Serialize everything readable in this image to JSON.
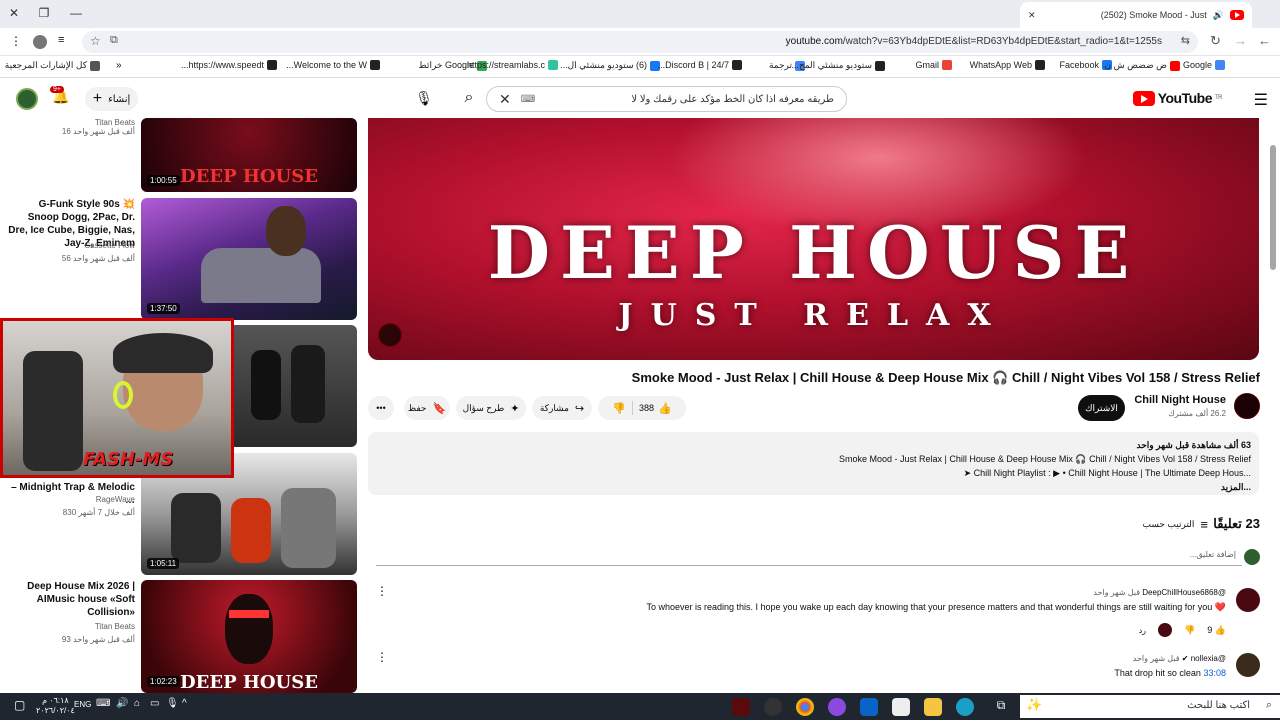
{
  "browser": {
    "tab_title": "(2502) Smoke Mood - Just",
    "url_host": "youtube.com",
    "url_rest": "/watch?v=63Yb4dpEDtE&list=RD63Yb4dpEDtE&start_radio=1&t=1255s"
  },
  "bookmarks": [
    {
      "label": "كل الإشارات المرجعية",
      "color": "#555"
    },
    {
      "label": "https://www.speedt...",
      "color": "#222"
    },
    {
      "label": "Welcome to the W...",
      "color": "#222"
    },
    {
      "label": "Google خرائط",
      "color": "#34a853"
    },
    {
      "label": "https://streamlabs.c...",
      "color": "#31c3a2"
    },
    {
      "label": "(6) ستوديو منشئي ال...",
      "color": "#1877f2"
    },
    {
      "label": "24/7 | Discord B...",
      "color": "#222"
    },
    {
      "label": "ترجمة",
      "color": "#4285f4"
    },
    {
      "label": "ستوديو منشئي المح...",
      "color": "#222"
    },
    {
      "label": "Gmail",
      "color": "#ea4335"
    },
    {
      "label": "WhatsApp Web",
      "color": "#222"
    },
    {
      "label": "Facebook",
      "color": "#1877f2"
    },
    {
      "label": "ض ضضض ش ن",
      "color": "#f00"
    },
    {
      "label": "Google",
      "color": "#4285f4"
    }
  ],
  "youtube": {
    "logo_text": "YouTube",
    "logo_region": "TR",
    "search_value": "طريقه معرفه اذا كان الخط مؤكد على رقمك ولا لا",
    "create_label": "إنشاء",
    "notif_count": "9+"
  },
  "sidebar": [
    {
      "title": "",
      "channel": "Titan Beats",
      "meta": "16 ألف  قبل شهر واحد",
      "duration": "1:00:55",
      "thumb_text": "DEEP HOUSE"
    },
    {
      "title": "G-Funk Style 90s 💥 Snoop Dogg, 2Pac, Dr. Dre, Ice Cube, Biggie, Nas, Jay-Z, Eminem",
      "channel": "Cassette Flow",
      "meta": "56 ألف  قبل شهر واحد",
      "duration": "1:37:50"
    },
    {
      "title": "– Midnight Trap & Melodic …",
      "channel": "RageWave",
      "meta": "830 ألف  خلال 7 أشهر",
      "duration": ""
    },
    {
      "title": "",
      "channel": "",
      "meta": "",
      "duration": "1:05:11"
    },
    {
      "title": "Deep House Mix 2026 | AIMusic house «Soft Collision»",
      "channel": "Titan Beats",
      "meta": "93 ألف  قبل شهر واحد",
      "duration": "1:02:23",
      "thumb_text": "DEEP HOUSE"
    }
  ],
  "video": {
    "overlay_title": "DEEP HOUSE",
    "overlay_sub": "JUST RELAX",
    "title": "Smoke Mood - Just Relax | Chill House & Deep House Mix 🎧 Chill / Night Vibes Vol 158 / Stress Relief",
    "channel": "Chill Night House",
    "subs": "26.2 ألف مشترك",
    "subscribe": "الاشتراك",
    "likes": "388",
    "share": "مشاركة",
    "ask": "طرح سؤال",
    "save": "حفظ"
  },
  "description": {
    "meta": "63 ألف مشاهدة  قبل شهر واحد",
    "line1": "Smoke Mood - Just Relax | Chill House & Deep House Mix 🎧 Chill / Night Vibes Vol 158 / Stress Relief",
    "line2": "➤  Chill Night Playlist :  ▶ • Chill Night House | The Ultimate Deep Hous...",
    "more": "...المزيد"
  },
  "comments": {
    "count": "23 تعليقًا",
    "sort": "الترتيب حسب",
    "add": "إضافة تعليق...",
    "items": [
      {
        "author": "@DeepChillHouse6868",
        "time": "قبل شهر واحد",
        "text": "To whoever is reading this. I hope you wake up each day knowing that your presence matters and that wonderful things are still waiting for you ❤️",
        "likes": "9",
        "reply": "رد"
      },
      {
        "author": "@nollexia",
        "time": "قبل شهر واحد",
        "text": "That drop hit so clean",
        "timestamp": "33:08"
      }
    ]
  },
  "stream": {
    "overlay_text": "FASH-MS"
  },
  "taskbar": {
    "search_placeholder": "اكتب هنا للبحث",
    "lang": "ENG",
    "time": "٠٦:١٨ م",
    "date": "٢٠٢٦/٠٢/٠٤"
  }
}
